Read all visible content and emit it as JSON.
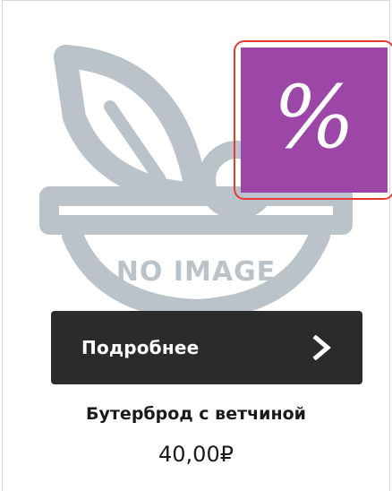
{
  "product": {
    "image_placeholder_text": "NO IMAGE",
    "discount_symbol": "%",
    "details_button_label": "Подробнее",
    "name": "Бутерброд с ветчиной",
    "price": "40,00₽"
  },
  "colors": {
    "badge": "#9c46a8",
    "badge_highlight": "#e53935",
    "button": "#2b2b2b",
    "placeholder": "#b9c3c9"
  },
  "icons": {
    "placeholder": "salad-bowl-icon",
    "button_arrow": "chevron-right-icon"
  }
}
